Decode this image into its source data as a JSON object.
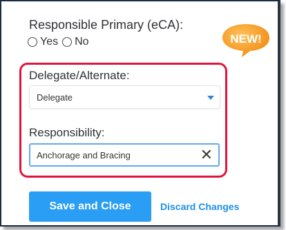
{
  "responsible_primary": {
    "label": "Responsible Primary (eCA):",
    "options": [
      "Yes",
      "No"
    ]
  },
  "badge": {
    "text": "NEW!",
    "color": "#f29121"
  },
  "delegate": {
    "label": "Delegate/Alternate:",
    "selected": "Delegate"
  },
  "responsibility": {
    "label": "Responsibility:",
    "value": "Anchorage and Bracing",
    "clear_icon": "close-icon"
  },
  "actions": {
    "save_label": "Save and Close",
    "discard_label": "Discard Changes"
  },
  "colors": {
    "accent": "#2a9df4",
    "highlight": "#e0143a"
  }
}
